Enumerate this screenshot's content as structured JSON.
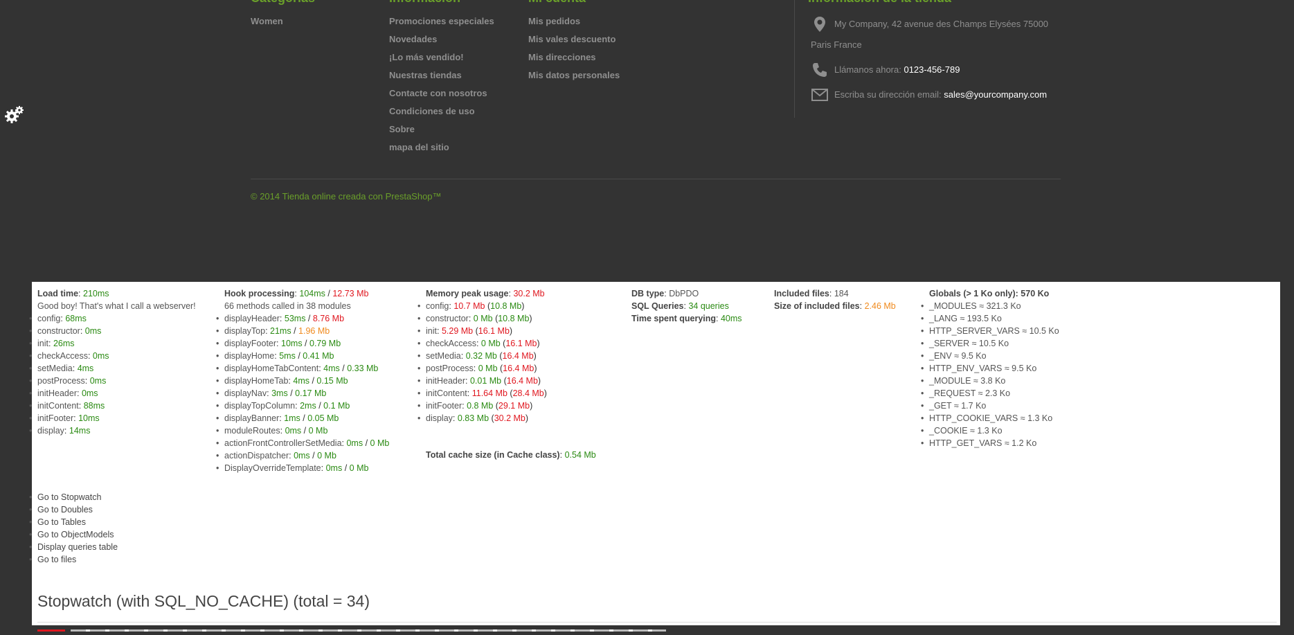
{
  "footer": {
    "categories": {
      "title": "Categorías",
      "items": [
        "Women"
      ]
    },
    "information": {
      "title": "Información",
      "items": [
        "Promociones especiales",
        "Novedades",
        "¡Lo más vendido!",
        "Nuestras tiendas",
        "Contacte con nosotros",
        "Condiciones de uso",
        "Sobre",
        "mapa del sitio"
      ]
    },
    "account": {
      "title": "Mi cuenta",
      "items": [
        "Mis pedidos",
        "Mis vales descuento",
        "Mis direcciones",
        "Mis datos personales"
      ]
    },
    "store": {
      "title": "Información de la tienda",
      "address_line1": "My Company, 42 avenue des Champs Elysées 75000",
      "address_line2": "Paris France",
      "phone_label": "Llámanos ahora:",
      "phone": "0123-456-789",
      "email_label": "Escriba su dirección email:",
      "email": "sales@yourcompany.com"
    },
    "copyright": "© 2014 Tienda online creada con PrestaShop™",
    "colors": {
      "accent": "#6a9f2a",
      "background": "#333333",
      "text_muted": "#8f8f8f"
    }
  },
  "profiler": {
    "load": {
      "label": "Load time",
      "value": "210ms",
      "comment": "Good boy! That's what I call a webserver!",
      "items": [
        {
          "name": "config",
          "value": "68ms"
        },
        {
          "name": "constructor",
          "value": "0ms"
        },
        {
          "name": "init",
          "value": "26ms"
        },
        {
          "name": "checkAccess",
          "value": "0ms"
        },
        {
          "name": "setMedia",
          "value": "4ms"
        },
        {
          "name": "postProcess",
          "value": "0ms"
        },
        {
          "name": "initHeader",
          "value": "0ms"
        },
        {
          "name": "initContent",
          "value": "88ms"
        },
        {
          "name": "initFooter",
          "value": "10ms"
        },
        {
          "name": "display",
          "value": "14ms"
        }
      ]
    },
    "hooks": {
      "label": "Hook processing",
      "time": "104ms",
      "mem": "12.73 Mb",
      "summary": "66 methods called in 38 modules",
      "items": [
        {
          "name": "displayHeader",
          "time": "53ms",
          "mem": "8.76 Mb",
          "mem_color": "r"
        },
        {
          "name": "displayTop",
          "time": "21ms",
          "mem": "1.96 Mb",
          "mem_color": "o"
        },
        {
          "name": "displayFooter",
          "time": "10ms",
          "mem": "0.79 Mb",
          "mem_color": "g"
        },
        {
          "name": "displayHome",
          "time": "5ms",
          "mem": "0.41 Mb",
          "mem_color": "g"
        },
        {
          "name": "displayHomeTabContent",
          "time": "4ms",
          "mem": "0.33 Mb",
          "mem_color": "g"
        },
        {
          "name": "displayHomeTab",
          "time": "4ms",
          "mem": "0.15 Mb",
          "mem_color": "g"
        },
        {
          "name": "displayNav",
          "time": "3ms",
          "mem": "0.17 Mb",
          "mem_color": "g"
        },
        {
          "name": "displayTopColumn",
          "time": "2ms",
          "mem": "0.1 Mb",
          "mem_color": "g"
        },
        {
          "name": "displayBanner",
          "time": "1ms",
          "mem": "0.05 Mb",
          "mem_color": "g"
        },
        {
          "name": "moduleRoutes",
          "time": "0ms",
          "mem": "0 Mb",
          "mem_color": "g"
        },
        {
          "name": "actionFrontControllerSetMedia",
          "time": "0ms",
          "mem": "0 Mb",
          "mem_color": "g"
        },
        {
          "name": "actionDispatcher",
          "time": "0ms",
          "mem": "0 Mb",
          "mem_color": "g"
        },
        {
          "name": "DisplayOverrideTemplate",
          "time": "0ms",
          "mem": "0 Mb",
          "mem_color": "g"
        }
      ]
    },
    "memory": {
      "label": "Memory peak usage",
      "value": "30.2 Mb",
      "items": [
        {
          "name": "config",
          "used": "10.7 Mb",
          "used_color": "r",
          "peak": "10.8 Mb",
          "peak_color": "g"
        },
        {
          "name": "constructor",
          "used": "0 Mb",
          "used_color": "g",
          "peak": "10.8 Mb",
          "peak_color": "g"
        },
        {
          "name": "init",
          "used": "5.29 Mb",
          "used_color": "r",
          "peak": "16.1 Mb",
          "peak_color": "r"
        },
        {
          "name": "checkAccess",
          "used": "0 Mb",
          "used_color": "g",
          "peak": "16.1 Mb",
          "peak_color": "r"
        },
        {
          "name": "setMedia",
          "used": "0.32 Mb",
          "used_color": "g",
          "peak": "16.4 Mb",
          "peak_color": "r"
        },
        {
          "name": "postProcess",
          "used": "0 Mb",
          "used_color": "g",
          "peak": "16.4 Mb",
          "peak_color": "r"
        },
        {
          "name": "initHeader",
          "used": "0.01 Mb",
          "used_color": "g",
          "peak": "16.4 Mb",
          "peak_color": "r"
        },
        {
          "name": "initContent",
          "used": "11.64 Mb",
          "used_color": "r",
          "peak": "28.4 Mb",
          "peak_color": "r"
        },
        {
          "name": "initFooter",
          "used": "0.8 Mb",
          "used_color": "g",
          "peak": "29.1 Mb",
          "peak_color": "r"
        },
        {
          "name": "display",
          "used": "0.83 Mb",
          "used_color": "g",
          "peak": "30.2 Mb",
          "peak_color": "r"
        }
      ],
      "cache_label": "Total cache size (in Cache class)",
      "cache_value": "0.54 Mb"
    },
    "db": {
      "type_label": "DB type",
      "type_value": "DbPDO",
      "queries_label": "SQL Queries",
      "queries_value": "34 queries",
      "time_label": "Time spent querying",
      "time_value": "40ms"
    },
    "files": {
      "count_label": "Included files",
      "count_value": "184",
      "size_label": "Size of included files",
      "size_value": "2.46 Mb"
    },
    "globals": {
      "label": "Globals (> 1 Ko only): 570 Ko",
      "items": [
        "_MODULES ≈ 321.3 Ko",
        "_LANG ≈ 193.5 Ko",
        "HTTP_SERVER_VARS ≈ 10.5 Ko",
        "_SERVER ≈ 10.5 Ko",
        "_ENV ≈ 9.5 Ko",
        "HTTP_ENV_VARS ≈ 9.5 Ko",
        "_MODULE ≈ 3.8 Ko",
        "_REQUEST ≈ 2.3 Ko",
        "_GET ≈ 1.7 Ko",
        "HTTP_COOKIE_VARS ≈ 1.3 Ko",
        "_COOKIE ≈ 1.3 Ko",
        "HTTP_GET_VARS ≈ 1.2 Ko"
      ]
    },
    "links": [
      "Go to Stopwatch",
      "Go to Doubles",
      "Go to Tables",
      "Go to ObjectModels",
      "Display queries table",
      "Go to files"
    ],
    "stopwatch_title": "Stopwatch (with SQL_NO_CACHE) (total = 34)",
    "colors": {
      "good": "#2a8a12",
      "bad": "#e0171f",
      "warn": "#f08a1d"
    }
  }
}
